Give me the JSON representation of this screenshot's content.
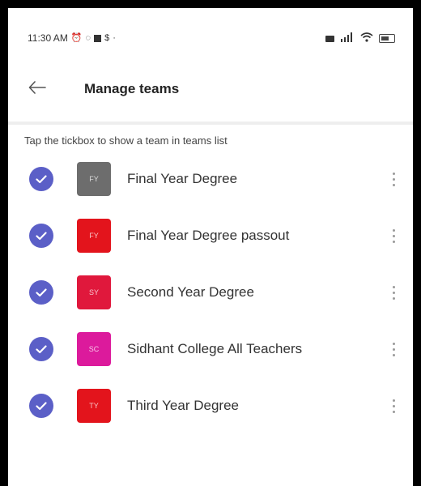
{
  "status_bar": {
    "time": "11:30 AM",
    "icons": [
      "alarm-icon",
      "whatsapp-icon",
      "notification-icon",
      "sim-icon"
    ],
    "right_icons": [
      "hd-icon",
      "signal-icon",
      "wifi-icon",
      "battery-icon"
    ]
  },
  "header": {
    "back_icon": "arrow-left-icon",
    "title": "Manage teams"
  },
  "hint": "Tap the tickbox to show a team in teams list",
  "colors": {
    "check": "#5b5fc7"
  },
  "teams": [
    {
      "name": "Final Year Degree",
      "initials": "FY",
      "color": "#6d6d6d",
      "checked": true
    },
    {
      "name": "Final Year Degree passout",
      "initials": "FY",
      "color": "#e3141c",
      "checked": true
    },
    {
      "name": "Second Year Degree",
      "initials": "SY",
      "color": "#e0183c",
      "checked": true
    },
    {
      "name": "Sidhant College All Teachers",
      "initials": "SC",
      "color": "#dc1a9c",
      "checked": true
    },
    {
      "name": "Third Year Degree",
      "initials": "TY",
      "color": "#e3141c",
      "checked": true
    }
  ]
}
